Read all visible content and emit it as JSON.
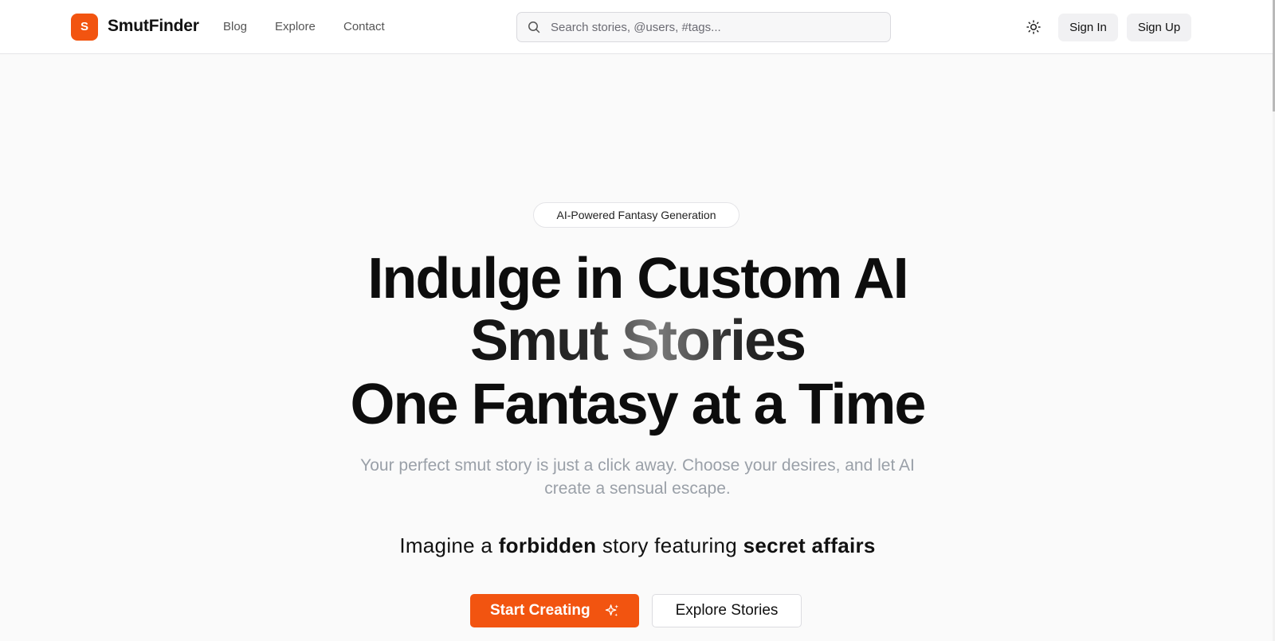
{
  "header": {
    "logo_letter": "S",
    "brand": "SmutFinder",
    "nav": [
      {
        "label": "Blog"
      },
      {
        "label": "Explore"
      },
      {
        "label": "Contact"
      }
    ],
    "search_placeholder": "Search stories, @users, #tags...",
    "theme_icon": "sun-icon",
    "sign_in": "Sign In",
    "sign_up": "Sign Up"
  },
  "hero": {
    "badge": "AI-Powered Fantasy Generation",
    "headline_line1": "Indulge in Custom AI",
    "headline_line2": "Smut Stories",
    "headline_line3": "One Fantasy at a Time",
    "subtitle": "Your perfect smut story is just a click away. Choose your desires, and let AI create a sensual escape.",
    "imagine_prefix": "Imagine a ",
    "imagine_word1": "forbidden",
    "imagine_mid": " story featuring ",
    "imagine_word2": "secret affairs",
    "primary_cta": "Start Creating",
    "primary_cta_icon": "sparkles-icon",
    "secondary_cta": "Explore Stories"
  },
  "colors": {
    "brand": "#f25410",
    "subtitle": "#9aa0a8"
  }
}
